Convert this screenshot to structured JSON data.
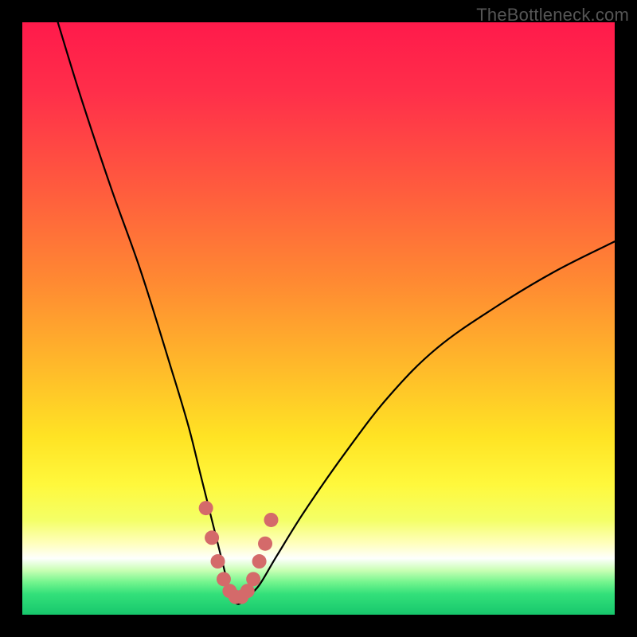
{
  "watermark": "TheBottleneck.com",
  "chart_data": {
    "type": "line",
    "title": "",
    "xlabel": "",
    "ylabel": "",
    "xlim": [
      0,
      100
    ],
    "ylim": [
      0,
      100
    ],
    "series": [
      {
        "name": "bottleneck-curve",
        "x": [
          6,
          10,
          15,
          20,
          25,
          28,
          30,
          32,
          34,
          35,
          36,
          37,
          38,
          40,
          43,
          48,
          55,
          62,
          70,
          80,
          90,
          100
        ],
        "values": [
          100,
          87,
          72,
          58,
          42,
          32,
          24,
          16,
          8,
          4,
          2,
          2,
          3,
          5,
          10,
          18,
          28,
          37,
          45,
          52,
          58,
          63
        ]
      }
    ],
    "markers": {
      "name": "highlight-dots",
      "x": [
        31,
        32,
        33,
        34,
        35,
        36,
        37,
        38,
        39,
        40,
        41,
        42
      ],
      "values": [
        18,
        13,
        9,
        6,
        4,
        3,
        3,
        4,
        6,
        9,
        12,
        16
      ],
      "color": "#d46a6a",
      "radius": 9
    },
    "background_gradient": {
      "stops": [
        {
          "offset": 0.0,
          "color": "#ff1a4b"
        },
        {
          "offset": 0.12,
          "color": "#ff2f4a"
        },
        {
          "offset": 0.28,
          "color": "#ff5b3e"
        },
        {
          "offset": 0.44,
          "color": "#ff8a32"
        },
        {
          "offset": 0.58,
          "color": "#ffb92a"
        },
        {
          "offset": 0.7,
          "color": "#ffe324"
        },
        {
          "offset": 0.78,
          "color": "#fff83c"
        },
        {
          "offset": 0.84,
          "color": "#f4ff66"
        },
        {
          "offset": 0.88,
          "color": "#ffffbe"
        },
        {
          "offset": 0.905,
          "color": "#fdfffd"
        },
        {
          "offset": 0.925,
          "color": "#c9ffb4"
        },
        {
          "offset": 0.945,
          "color": "#74f58e"
        },
        {
          "offset": 0.965,
          "color": "#33e07a"
        },
        {
          "offset": 1.0,
          "color": "#17c76c"
        }
      ]
    }
  }
}
